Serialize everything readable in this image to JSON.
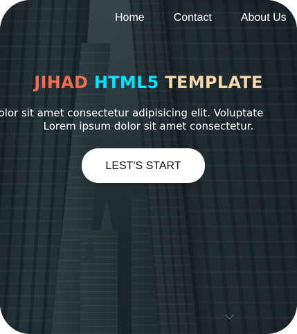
{
  "nav": {
    "items": [
      {
        "label": "Home"
      },
      {
        "label": "Contact"
      },
      {
        "label": "About Us"
      }
    ]
  },
  "hero": {
    "title": {
      "part1": "JIHAD",
      "part2": "HTML5",
      "part3": "TEMPLATE"
    },
    "text": {
      "line1": "dolor sit amet consectetur adipisicing elit. Voluptate",
      "line2": "Lorem ipsum dolor sit amet consectetur."
    },
    "cta_label": "LEST'S START"
  },
  "icons": {
    "scroll": "chevron-down-icon"
  },
  "colors": {
    "title_part1": "#f26c4f",
    "title_part2": "#00e6ff",
    "title_part3": "#f3d8ab",
    "button_bg": "#ffffff",
    "text": "#ffffff"
  }
}
